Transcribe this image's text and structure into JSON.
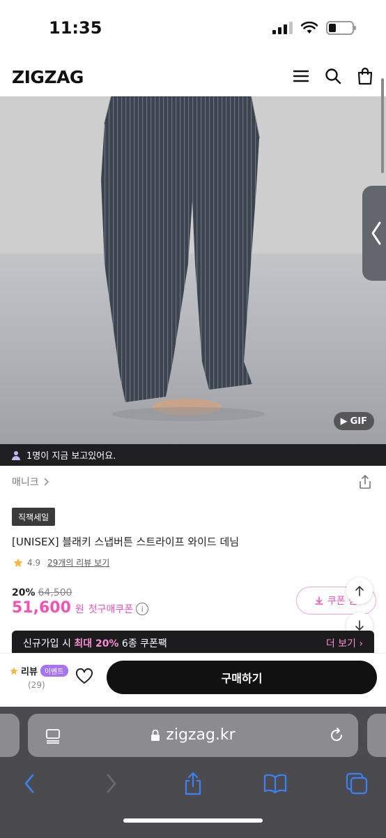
{
  "status": {
    "time": "11:35"
  },
  "header": {
    "logo": "ZIGZAG",
    "icons": [
      "menu-icon",
      "search-icon",
      "shopping-bag-icon"
    ]
  },
  "gallery": {
    "gif_label": "GIF"
  },
  "viewer_notice": "1명이 지금 보고있어요.",
  "product": {
    "brand": "매니크",
    "badge": "직잭세일",
    "title": "[UNISEX] 블래키 스냅버튼 스트라이프 와이드 데님",
    "rating": "4.9",
    "review_link": "29개의 리뷰 보기",
    "discount_rate": "20%",
    "original_price": "64,500",
    "sale_price": "51,600",
    "currency": "원",
    "coupon_label": "첫구매쿠폰",
    "coupon_button": "쿠폰 받"
  },
  "promo": {
    "text_prefix": "신규가입 시 ",
    "text_highlight": "최대 20%",
    "text_suffix": " 6종 쿠폰팩",
    "more": "더 보기"
  },
  "bottom_bar": {
    "review_label": "리뷰",
    "event_badge": "이벤트",
    "review_count": "(29)",
    "buy_button": "구매하기"
  },
  "browser": {
    "url": "zigzag.kr"
  },
  "colors": {
    "accent_pink": "#f152b5",
    "event_purple": "#a773f5",
    "dark": "#111111"
  }
}
